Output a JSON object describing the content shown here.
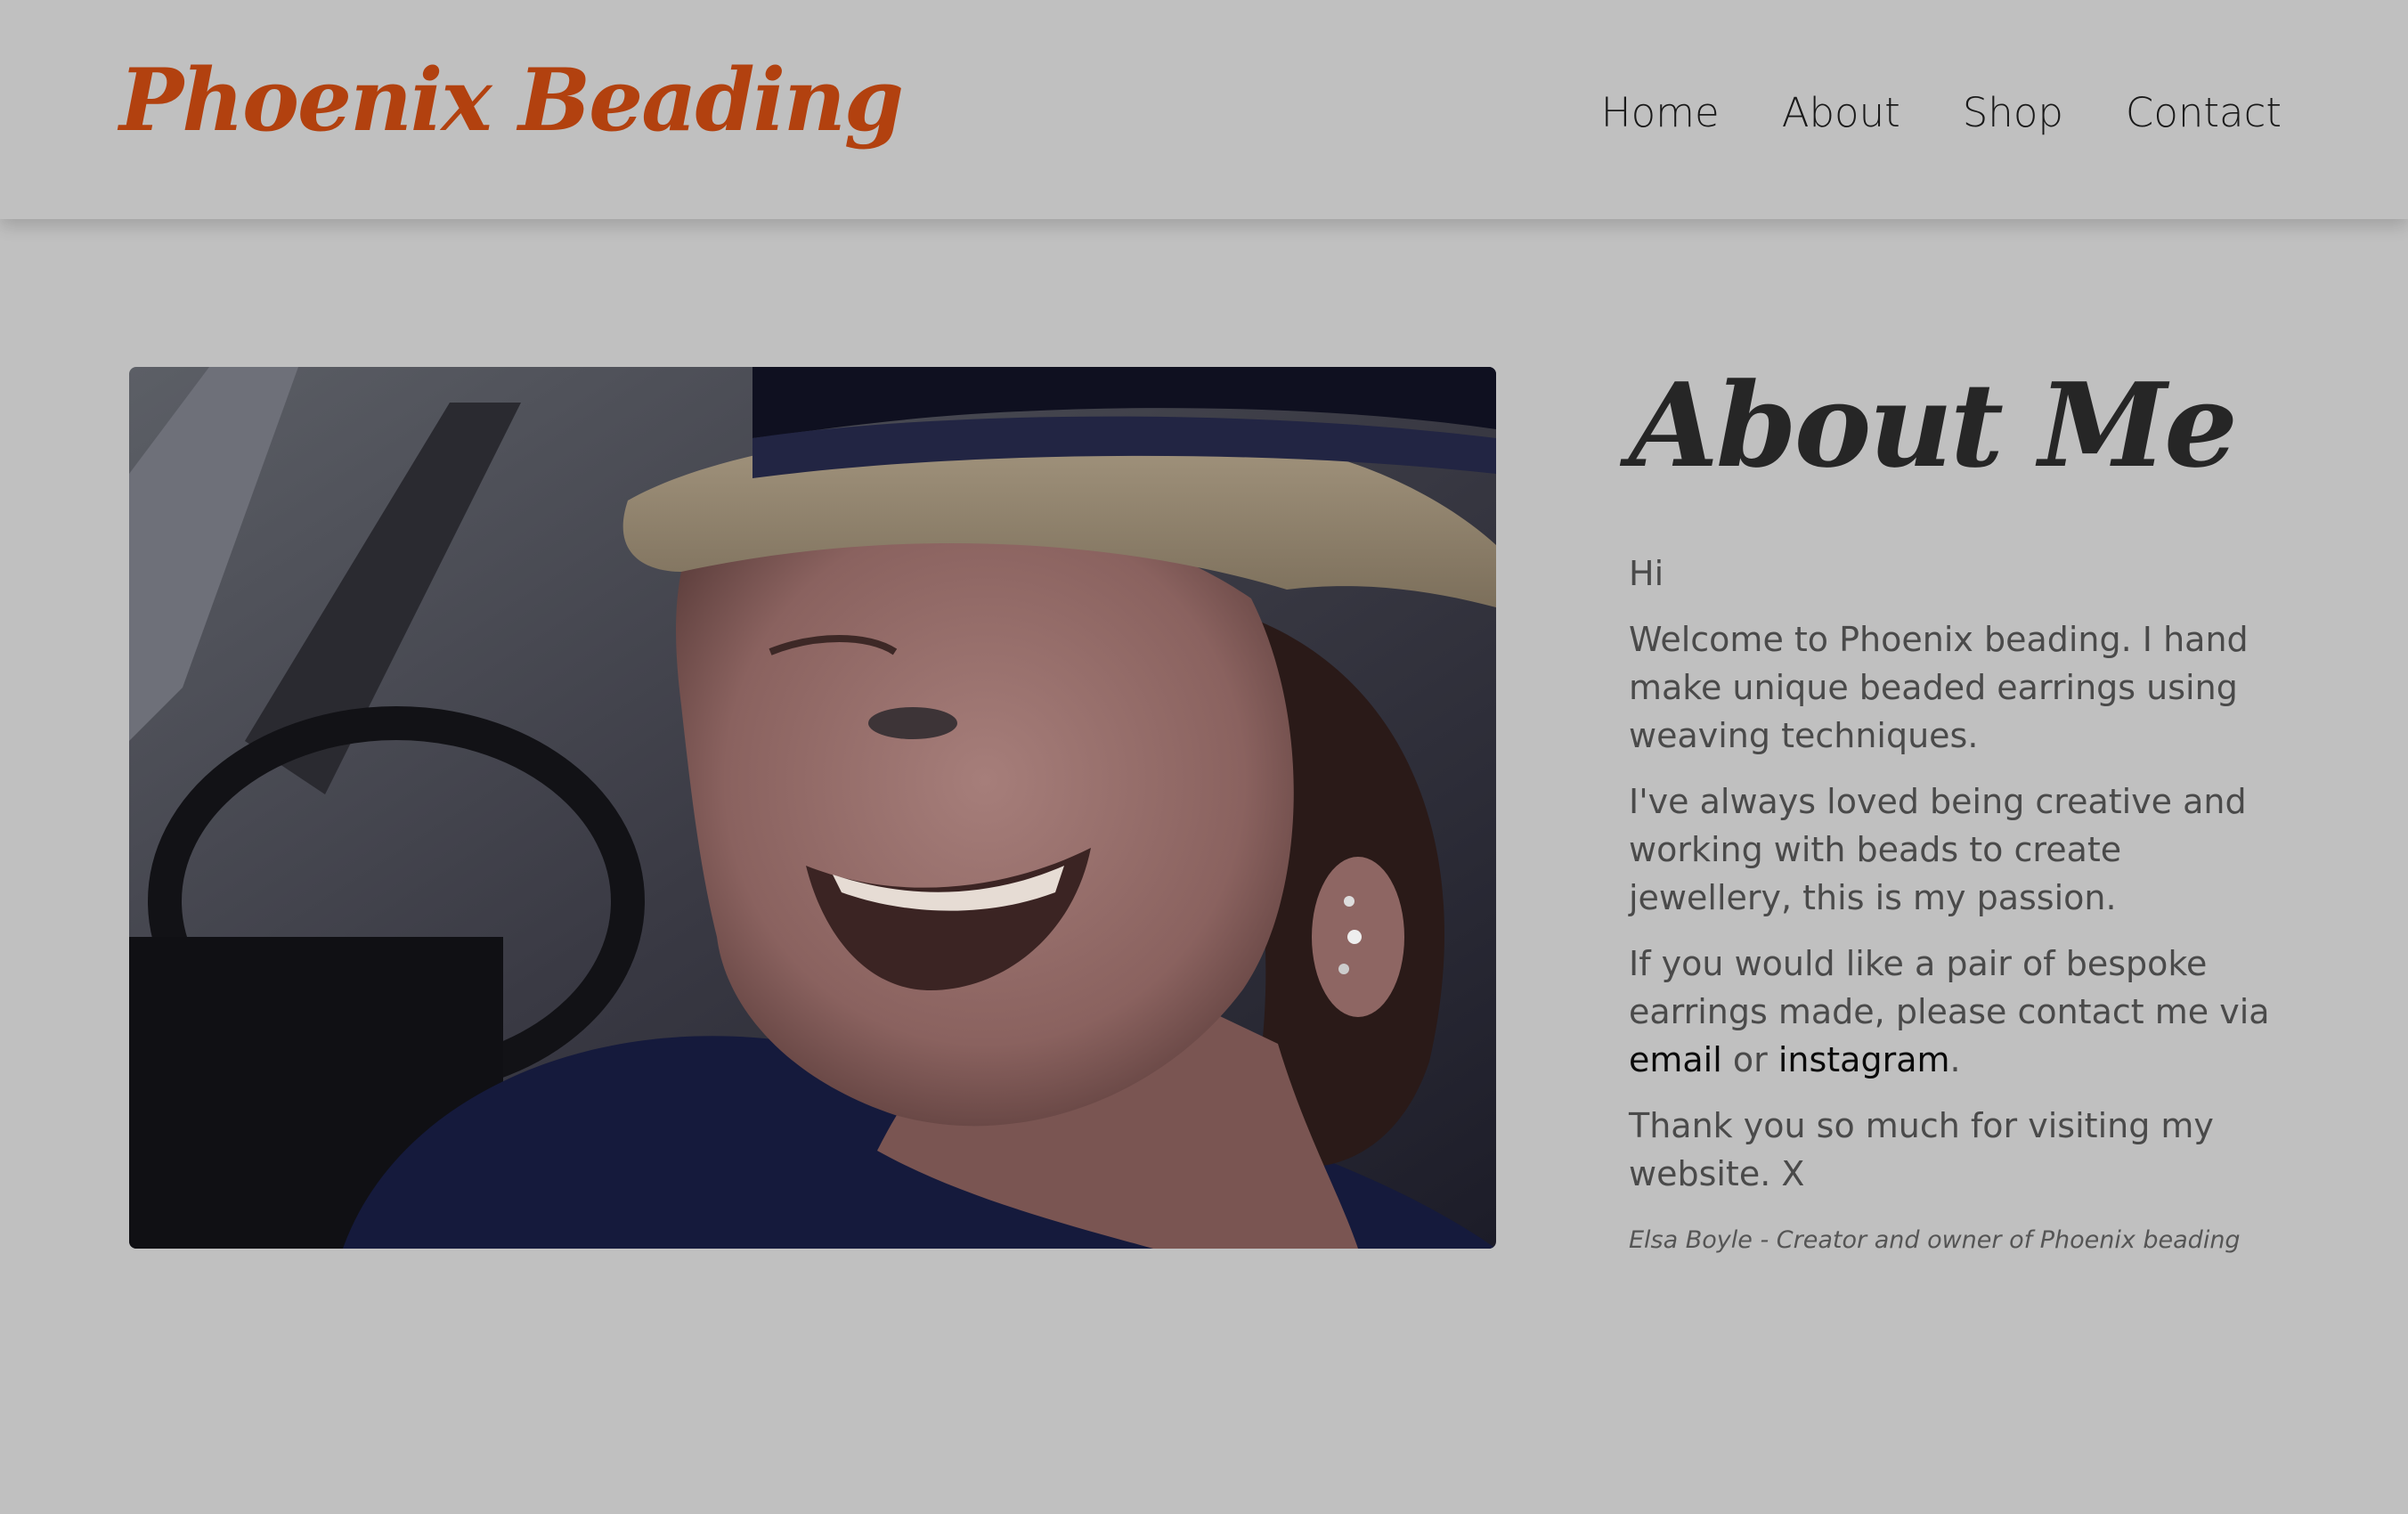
{
  "header": {
    "brand": "Phoenix Beading",
    "nav": [
      "Home",
      "About",
      "Shop",
      "Contact"
    ]
  },
  "hero_image": {
    "alt": "Smiling woman wearing a straw hat"
  },
  "about": {
    "title": "About Me",
    "greeting": "Hi",
    "paragraph1": "Welcome to Phoenix beading. I hand make unique beaded earrings using weaving techniques.",
    "paragraph2": "I've always loved being creative and working with beads to create jewellery, this is my passion.",
    "paragraph3_before": "If you would like a pair of bespoke earrings made, please contact me via ",
    "email_link": "email",
    "paragraph3_middle": " or ",
    "instagram_link": "instagram",
    "paragraph3_after": ".",
    "paragraph4": "Thank you so much for visiting my website. X",
    "signature": "Elsa Boyle - Creator and owner of Phoenix beading"
  },
  "colors": {
    "background": "#c0c0c0",
    "brand": "#b2410f",
    "text": "#4a4a4a"
  }
}
